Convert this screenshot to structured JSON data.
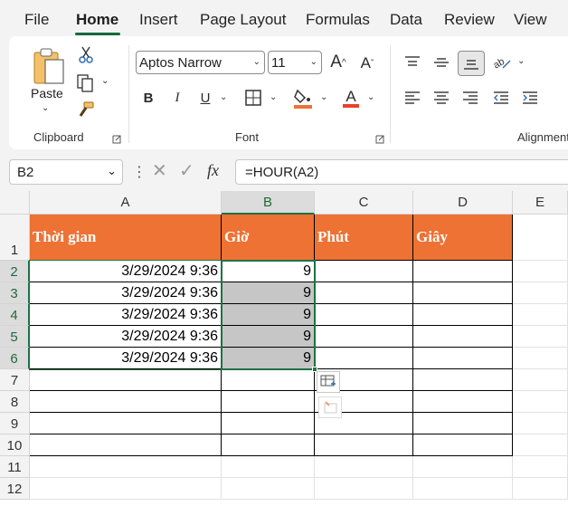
{
  "menu": {
    "tabs": [
      "File",
      "Home",
      "Insert",
      "Page Layout",
      "Formulas",
      "Data",
      "Review",
      "View"
    ],
    "active": "Home"
  },
  "ribbon": {
    "clipboard": {
      "paste_label": "Paste",
      "group_label": "Clipboard"
    },
    "font": {
      "font_name": "Aptos Narrow",
      "font_size": "11",
      "group_label": "Font",
      "font_color": "#e8412c",
      "fill_color": "#ed7234"
    },
    "alignment": {
      "group_label": "Alignment"
    }
  },
  "formula_bar": {
    "name_box": "B2",
    "formula": "=HOUR(A2)",
    "fx_label": "fx"
  },
  "columns": [
    "A",
    "B",
    "C",
    "D",
    "E"
  ],
  "rows": [
    "1",
    "2",
    "3",
    "4",
    "5",
    "6",
    "7",
    "8",
    "9",
    "10",
    "11",
    "12"
  ],
  "table": {
    "headers": [
      "Thời gian",
      "Giờ",
      "Phút",
      "Giây"
    ],
    "rows": [
      [
        "3/29/2024 9:36",
        "9",
        "",
        ""
      ],
      [
        "3/29/2024 9:36",
        "9",
        "",
        ""
      ],
      [
        "3/29/2024 9:36",
        "9",
        "",
        ""
      ],
      [
        "3/29/2024 9:36",
        "9",
        "",
        ""
      ],
      [
        "3/29/2024 9:36",
        "9",
        "",
        ""
      ]
    ]
  },
  "colors": {
    "accent": "#116b3a",
    "header_fill": "#ed7234",
    "selection": "#1e7145"
  }
}
